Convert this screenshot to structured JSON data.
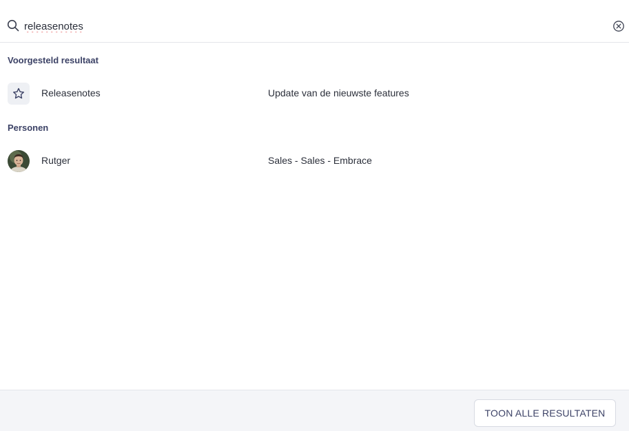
{
  "search": {
    "query": "releasenotes",
    "icon": "search-icon",
    "clear_icon": "clear-icon"
  },
  "sections": [
    {
      "heading": "Voorgesteld resultaat",
      "items": [
        {
          "title": "Releasenotes",
          "description": "Update van de nieuwste features",
          "icon": "star-icon"
        }
      ]
    },
    {
      "heading": "Personen",
      "items": [
        {
          "title": "Rutger",
          "description": "Sales - Sales - Embrace",
          "icon": "avatar"
        }
      ]
    }
  ],
  "footer": {
    "show_all_label": "TOON ALLE RESULTATEN"
  },
  "colors": {
    "heading": "#3c4266",
    "text": "#2b2f3a",
    "footer_bg": "#f4f5f8",
    "icon_box_bg": "#eef0f4"
  }
}
